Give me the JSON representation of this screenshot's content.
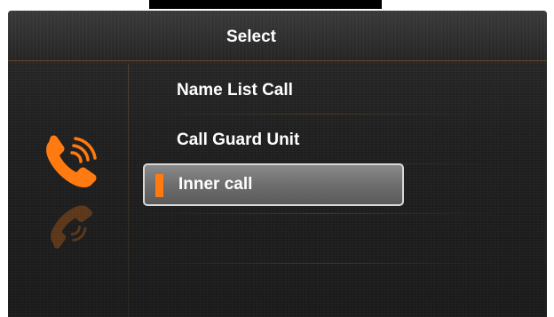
{
  "screen": {
    "title": "Select"
  },
  "menu": {
    "items": [
      {
        "label": "Name List Call",
        "selected": false
      },
      {
        "label": "Call Guard Unit",
        "selected": false
      },
      {
        "label": "Inner call",
        "selected": true
      }
    ]
  },
  "icons": {
    "side": "phone-call-icon"
  },
  "colors": {
    "accent": "#ff7a10",
    "background": "#1f1f1f",
    "text": "#ffffff",
    "selected_fill": "#7a7a7a",
    "selected_border": "#d8d8d8"
  }
}
